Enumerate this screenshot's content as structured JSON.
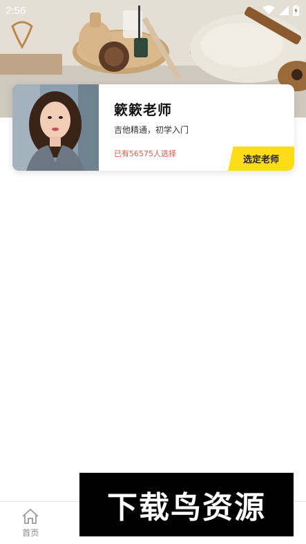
{
  "status_bar": {
    "time": "2:56",
    "icons": [
      "wifi-icon",
      "signal-icon",
      "battery-icon"
    ]
  },
  "hero": {
    "description_icon": "banner-image"
  },
  "teacher_card": {
    "name": "簌簌老师",
    "description": "吉他精通，初学入门",
    "selected_count": "已有56575人选择",
    "select_button": "选定老师"
  },
  "bottom_nav": {
    "items": [
      {
        "label": "首页",
        "icon": "home-icon"
      },
      {
        "label": "",
        "icon": "nav-icon-2"
      },
      {
        "label": "",
        "icon": "nav-icon-3"
      },
      {
        "label": "",
        "icon": "nav-icon-4"
      },
      {
        "label": "",
        "icon": "nav-icon-5"
      }
    ]
  },
  "watermark": {
    "text": "下载鸟资源"
  },
  "colors": {
    "accent_yellow": "#ffdc18",
    "count_red": "#e0584b",
    "nav_gray": "#888888"
  }
}
